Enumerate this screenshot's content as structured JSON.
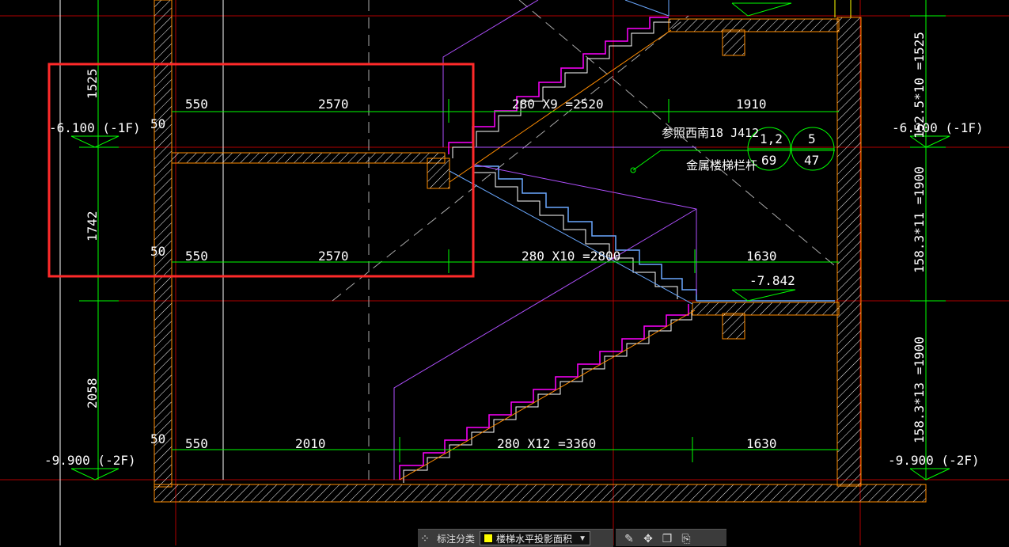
{
  "colors": {
    "dimension": "#00ff00",
    "wall": "#ff8c00",
    "axis": "#ff0000",
    "stair_magenta": "#ff00ff",
    "stair_blue": "#6aa8ff",
    "text": "#ffffff",
    "selection": "#ff2a2a",
    "yellow": "#ffff00"
  },
  "elevations": {
    "upper_left": "-6.100 (-1F)",
    "upper_right": "-6.100 (-1F)",
    "lower_left": "-9.900 (-2F)",
    "lower_right": "-9.900 (-2F)",
    "landing": "-7.842"
  },
  "dims_left": {
    "d1": "1525",
    "d2": "1742",
    "d3": "2058"
  },
  "dims_right": {
    "d1": "152.5*10 =1525",
    "d2": "158.3*11 =1900",
    "d3": "158.3*13 =1900"
  },
  "row1": {
    "gap": "50",
    "a": "550",
    "b": "2570",
    "c": "280 X9 =2520",
    "d": "1910"
  },
  "row2": {
    "gap": "50",
    "a": "550",
    "b": "2570",
    "c": "280 X10 =2800",
    "d": "1630"
  },
  "row3": {
    "gap": "50",
    "a": "550",
    "b": "2010",
    "c": "280 X12 =3360",
    "d": "1630"
  },
  "note": {
    "ref": "参照西南18 J412",
    "railing": "金属楼梯栏杆",
    "circle1_top": "1,2",
    "circle1_bottom": "69",
    "circle2_top": "5",
    "circle2_bottom": "47"
  },
  "toolbar": {
    "label": "标注分类",
    "selected": "楼梯水平投影面积"
  }
}
